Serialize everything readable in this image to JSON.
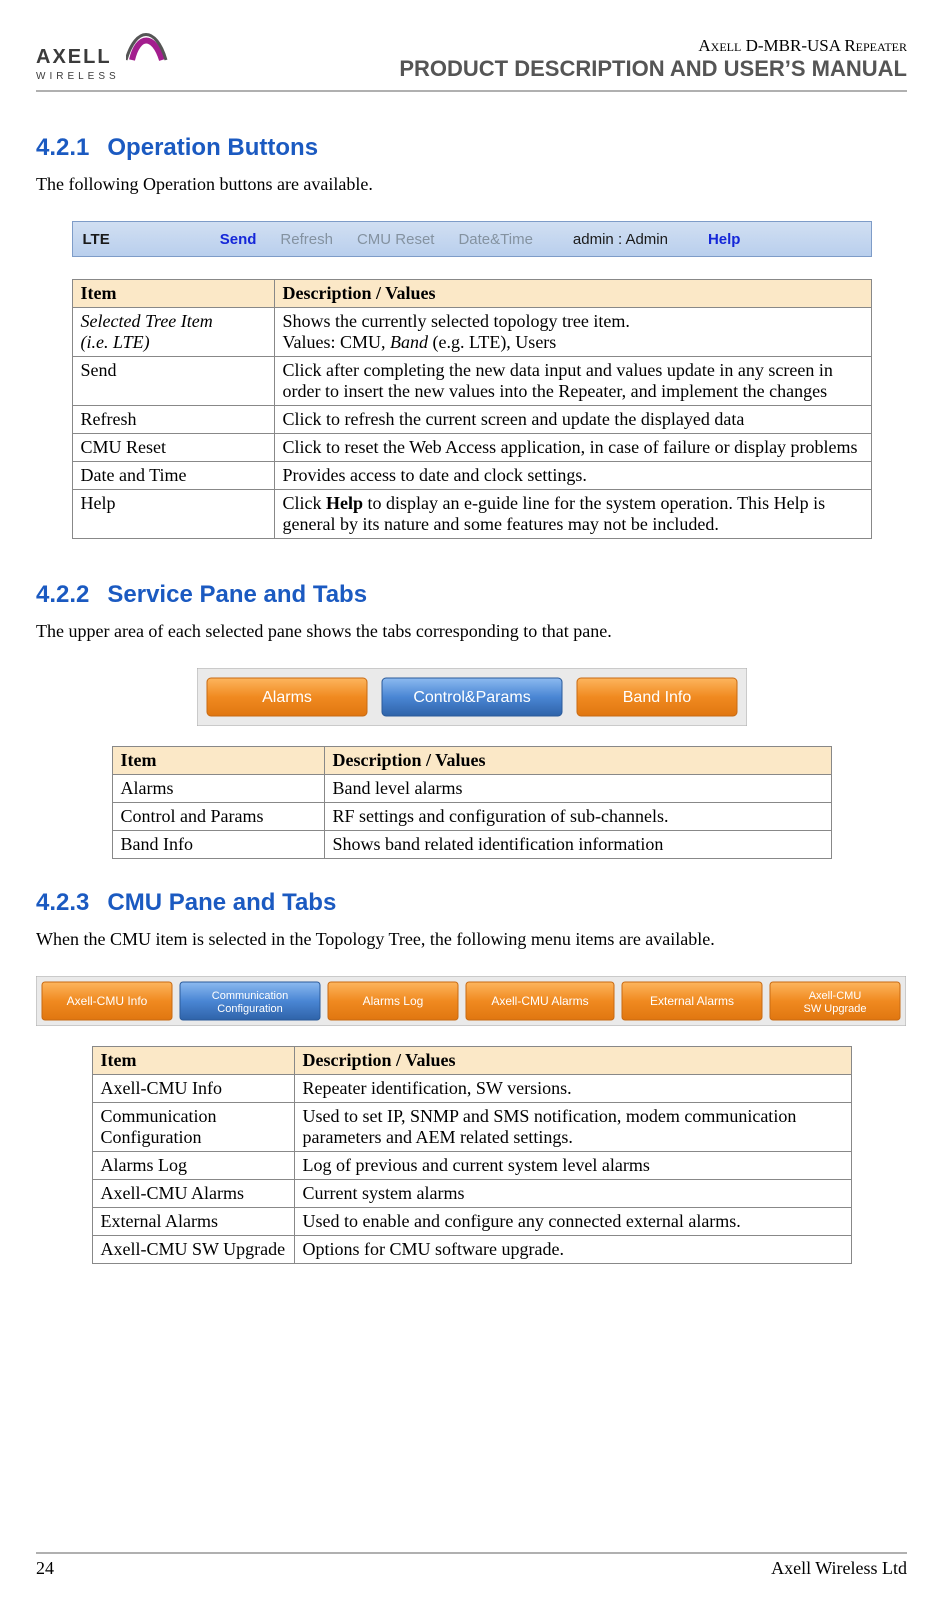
{
  "header": {
    "brand_top": "AXELL",
    "brand_bottom": "WIRELESS",
    "right_line1_a": "Axell D-MBR-USA ",
    "right_line1_b": "Repeater",
    "right_line2": "PRODUCT DESCRIPTION AND USER’S MANUAL"
  },
  "s1": {
    "num": "4.2.1",
    "title": "Operation Buttons",
    "intro": "The following Operation buttons are available.",
    "toolbar": {
      "lte": "LTE",
      "send": "Send",
      "refresh": "Refresh",
      "cmu_reset": "CMU Reset",
      "datetime": "Date&Time",
      "admin": "admin : Admin",
      "help": "Help"
    },
    "table": {
      "h1": "Item",
      "h2": "Description / Values",
      "rows": [
        {
          "item_i_a": "Selected Tree Item",
          "item_i_b": "(i.e. LTE)",
          "desc_a": "Shows the currently selected topology tree item.",
          "desc_b_pre": "Values: CMU, ",
          "desc_b_i": "Band",
          "desc_b_post": " (e.g. LTE), Users"
        },
        {
          "item": "Send",
          "desc": "Click after completing the new data input and values update in any screen in order to insert the new values into the Repeater, and implement the changes"
        },
        {
          "item": "Refresh",
          "desc": "Click to refresh the current screen and update the displayed data"
        },
        {
          "item": "CMU Reset",
          "desc": "Click to reset the Web Access application, in case of failure or display problems"
        },
        {
          "item": "Date and Time",
          "desc": "Provides access to date and clock settings."
        },
        {
          "item": "Help",
          "desc_pre": "Click ",
          "desc_b": "Help",
          "desc_post": " to display an e-guide line for the system operation.  This Help is general by its nature and some features may not be included."
        }
      ]
    }
  },
  "s2": {
    "num": "4.2.2",
    "title": "Service Pane and Tabs",
    "intro": "The upper area of each selected pane shows the tabs corresponding to that pane.",
    "tabs": [
      "Alarms",
      "Control&Params",
      "Band Info"
    ],
    "table": {
      "h1": "Item",
      "h2": "Description / Values",
      "rows": [
        {
          "item": "Alarms",
          "desc": "Band level alarms"
        },
        {
          "item": "Control and Params",
          "desc": "RF settings and configuration of sub-channels."
        },
        {
          "item": "Band Info",
          "desc": "Shows band related identification  information"
        }
      ]
    }
  },
  "s3": {
    "num": "4.2.3",
    "title": "CMU Pane and Tabs",
    "intro": "When the CMU item is selected in the Topology Tree, the following menu items are available.",
    "tabs": [
      "Axell-CMU Info",
      "Communication Configuration",
      "Alarms Log",
      "Axell-CMU Alarms",
      "External Alarms",
      "Axell-CMU SW Upgrade"
    ],
    "table": {
      "h1": "Item",
      "h2": "Description / Values",
      "rows": [
        {
          "item": "Axell-CMU Info",
          "desc": "Repeater identification, SW versions."
        },
        {
          "item": "Communication Configuration",
          "desc": "Used to set IP, SNMP and SMS notification, modem communication parameters and AEM related settings."
        },
        {
          "item": "Alarms Log",
          "desc": "Log of previous and current system level alarms"
        },
        {
          "item": "Axell-CMU Alarms",
          "desc": "Current system alarms"
        },
        {
          "item": "External Alarms",
          "desc": "Used to enable and configure any connected external alarms."
        },
        {
          "item": "Axell-CMU SW Upgrade",
          "desc": "Options for CMU software upgrade."
        }
      ]
    }
  },
  "footer": {
    "page": "24",
    "right": "Axell Wireless Ltd"
  }
}
